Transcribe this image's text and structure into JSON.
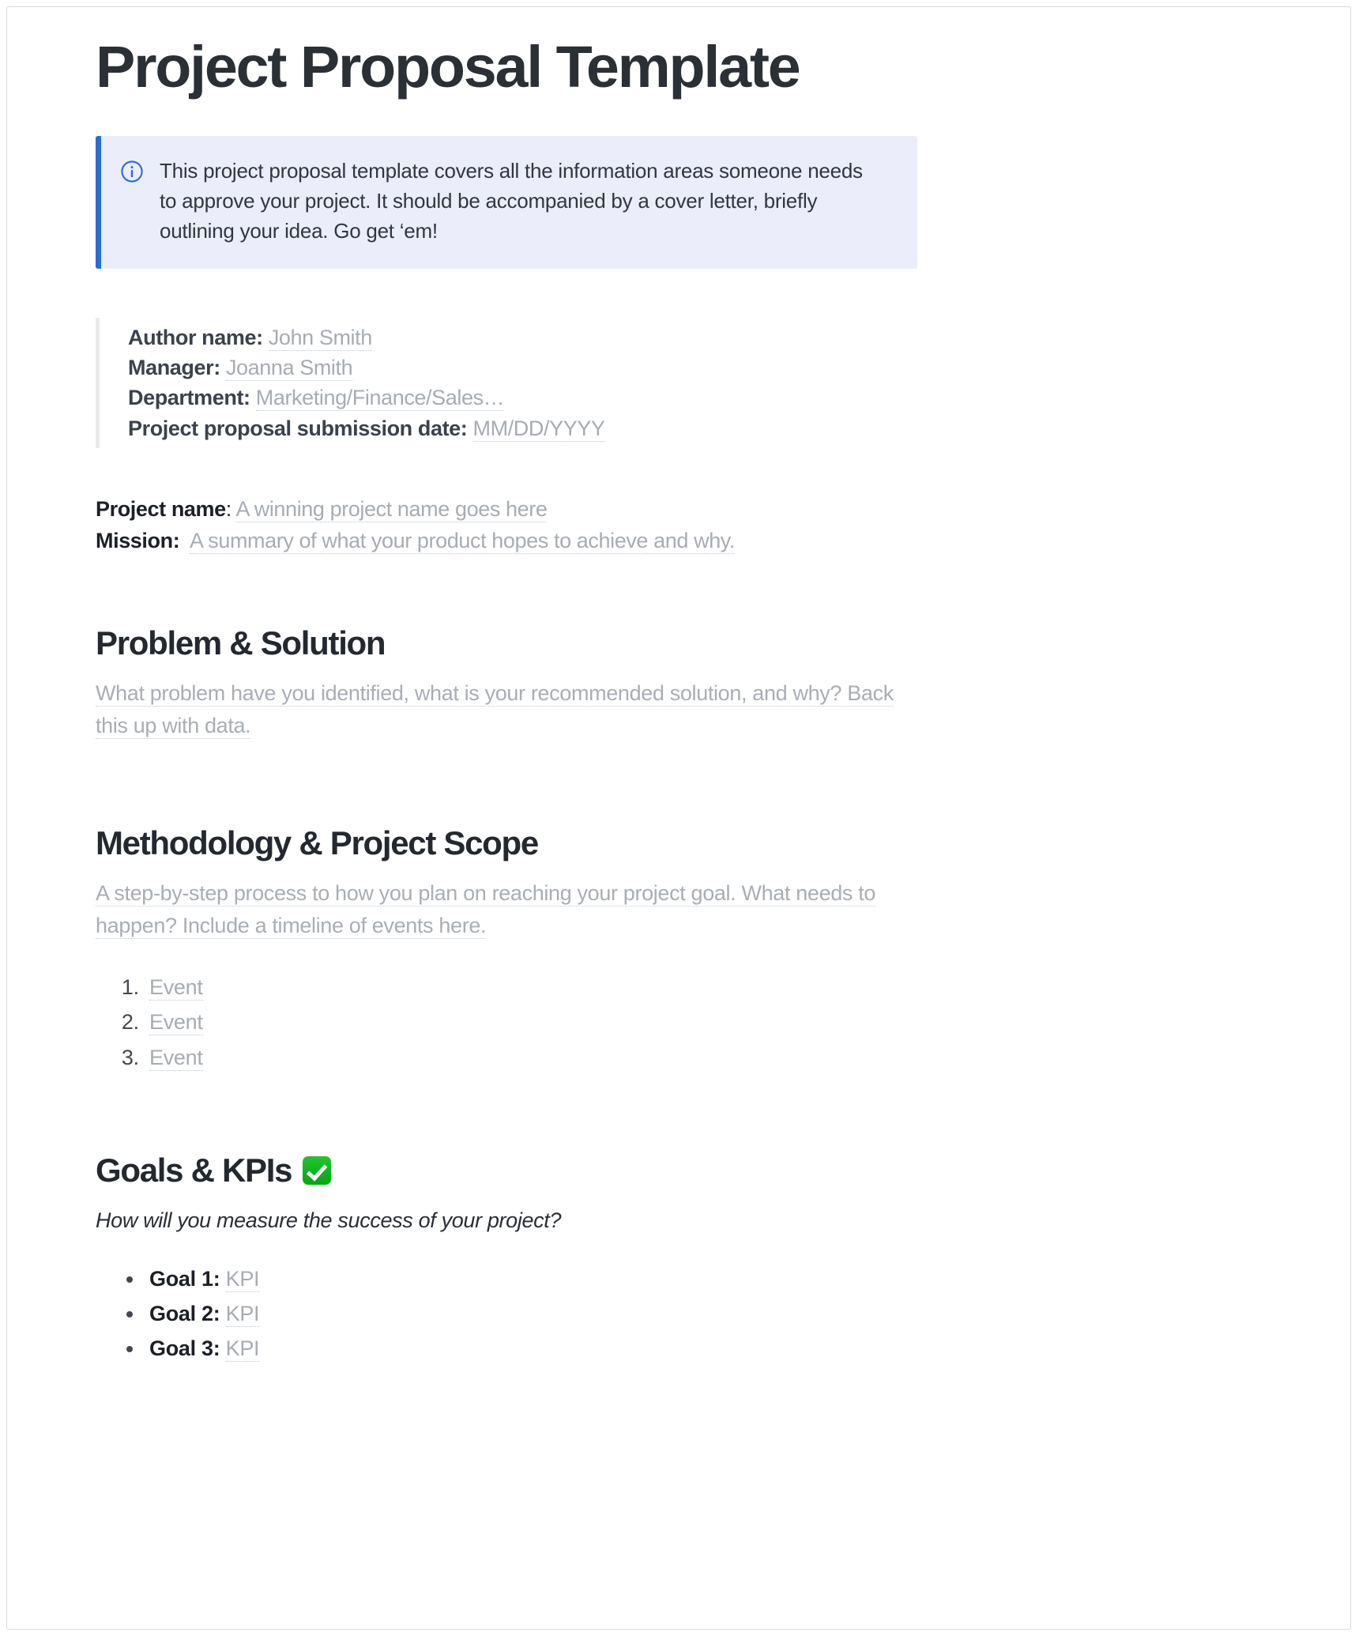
{
  "document": {
    "title": "Project Proposal Template"
  },
  "callout": {
    "icon": "info-circle-icon",
    "text": "This project proposal template covers all the information areas someone needs to approve your project. It should be accompanied by a cover letter, briefly outlining your idea. Go get ‘em!",
    "background_color": "#ebedfa",
    "accent_color": "#2b6bd4"
  },
  "meta": {
    "fields": [
      {
        "label": "Author name:",
        "placeholder": "John Smith"
      },
      {
        "label": "Manager:",
        "placeholder": "Joanna Smith"
      },
      {
        "label": "Department:",
        "placeholder": "Marketing/Finance/Sales…"
      },
      {
        "label": "Project proposal submission date:",
        "placeholder": "MM/DD/YYYY"
      }
    ]
  },
  "summary": {
    "project_name_key": "Project name",
    "project_name_sep": ": ",
    "project_name_placeholder": "A winning project name goes here",
    "mission_key": "Mission:",
    "mission_placeholder": "A summary of what your product hopes to achieve and why."
  },
  "sections": {
    "problem": {
      "heading": "Problem & Solution",
      "placeholder": "What problem have you identified, what is your recommended solution, and why? Back this up with data."
    },
    "methodology": {
      "heading": "Methodology & Project Scope",
      "placeholder": "A step-by-step process to how you plan on reaching your project goal. What needs to happen? Include a timeline of events here.",
      "events": [
        "Event",
        "Event",
        "Event"
      ]
    },
    "goals": {
      "heading": "Goals & KPIs",
      "heading_emoji": "white-check-mark",
      "note": "How will you measure the success of your project?",
      "items": [
        {
          "label": "Goal 1:",
          "placeholder": "KPI"
        },
        {
          "label": "Goal 2:",
          "placeholder": "KPI"
        },
        {
          "label": "Goal 3:",
          "placeholder": "KPI"
        }
      ]
    }
  }
}
